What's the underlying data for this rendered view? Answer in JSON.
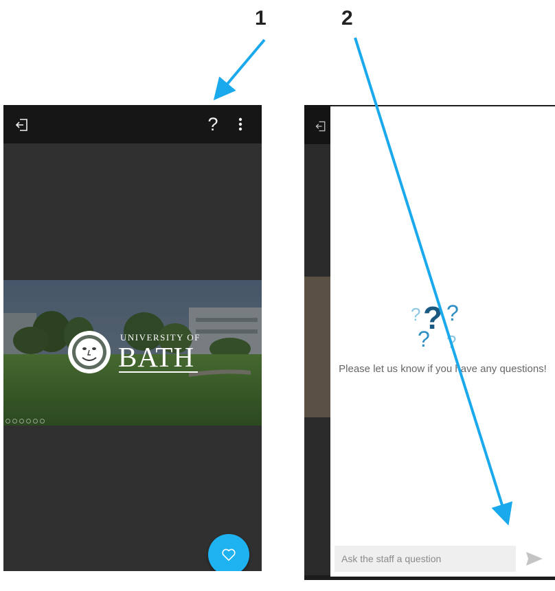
{
  "annotations": {
    "step1_label": "1",
    "step2_label": "2",
    "arrow_color": "#1aa9ec"
  },
  "phone1": {
    "topbar": {
      "exit_icon": "exit-icon",
      "help_icon_glyph": "?",
      "more_icon": "more-vertical-icon"
    },
    "slide": {
      "logo_line1": "UNIVERSITY OF",
      "logo_line2": "BATH"
    },
    "fab": {
      "icon": "heart-icon",
      "color": "#1fb2f0"
    }
  },
  "phone2": {
    "dialog": {
      "illustration": "question-marks-icon",
      "empty_message": "Please let us know if you have any questions!",
      "input_placeholder": "Ask the staff a question",
      "send_icon": "send-icon"
    }
  }
}
